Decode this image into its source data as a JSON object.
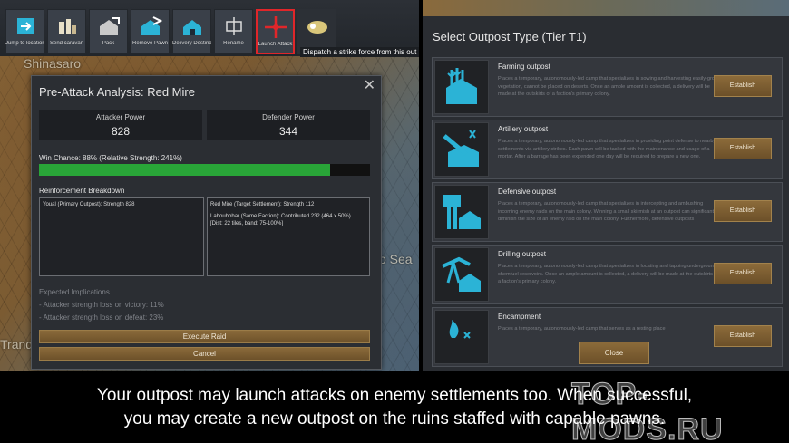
{
  "toolbar": {
    "buttons": [
      {
        "label": "Jump to location",
        "icon": "jump-icon"
      },
      {
        "label": "Send caravan",
        "icon": "caravan-icon"
      },
      {
        "label": "Pack",
        "icon": "pack-icon"
      },
      {
        "label": "Remove Pawn",
        "icon": "remove-pawn-icon"
      },
      {
        "label": "Delivery Destination",
        "icon": "delivery-icon"
      },
      {
        "label": "Rename",
        "icon": "rename-icon"
      },
      {
        "label": "Launch Attack",
        "icon": "crosshair-icon"
      },
      {
        "label": "",
        "icon": "strike-force-icon"
      }
    ],
    "tooltip": "Dispatch a strike force from this out"
  },
  "map": {
    "labels": [
      "Shinasaro",
      "o Sea",
      "Trand"
    ]
  },
  "attack_dialog": {
    "title": "Pre-Attack Analysis: Red Mire",
    "attacker_label": "Attacker Power",
    "attacker_value": "828",
    "defender_label": "Defender Power",
    "defender_value": "344",
    "win_chance_text": "Win Chance: 88% (Relative Strength: 241%)",
    "win_chance": 0.88,
    "reinforcement_label": "Reinforcement Breakdown",
    "reinf_left": [
      "Youal (Primary Outpost): Strength 828"
    ],
    "reinf_right": [
      "Red Mire (Target Settlement): Strength 112",
      "Laboubobar (Same Faction): Contributed 232 (464 x 50%)",
      "[Dist: 22 tiles, band: 75-100%]"
    ],
    "implications_title": "Expected Implications",
    "implications": [
      "- Attacker strength loss on victory: 11%",
      "- Attacker strength loss on defeat: 23%"
    ],
    "execute_label": "Execute Raid",
    "cancel_label": "Cancel"
  },
  "outpost_panel": {
    "title": "Select Outpost Type (Tier T1)",
    "establish_label": "Establish",
    "close_label": "Close",
    "items": [
      {
        "name": "Farming outpost",
        "icon": "farming-icon",
        "desc": "Places a temporary, autonomously-led camp that specializes in sowing and harvesting easily-grown vegetation, cannot be placed on deserts. Once an ample amount is collected, a delivery will be made at the outskirts of a faction's primary colony."
      },
      {
        "name": "Artillery outpost",
        "icon": "artillery-icon",
        "desc": "Places a temporary, autonomously-led camp that specializes in providing point defense to nearby settlements via artillery strikes. Each pawn will be tasked with the maintenance and usage of a mortar. After a barrage has been expended one day will be required to prepare a new one."
      },
      {
        "name": "Defensive outpost",
        "icon": "defensive-icon",
        "desc": "Places a temporary, autonomously-led camp that specializes in intercepting and ambushing incoming enemy raids on the main colony. Winning a small skirmish at an outpost can significantly diminish the size of an enemy raid on the main colony. Furthermore, defensive outposts"
      },
      {
        "name": "Drilling outpost",
        "icon": "drilling-icon",
        "desc": "Places a temporary, autonomously-led camp that specializes in locating and tapping underground chemfuel reservoirs. Once an ample amount is collected, a delivery will be made at the outskirts of a faction's primary colony."
      },
      {
        "name": "Encampment",
        "icon": "encampment-icon",
        "desc": "Places a temporary, autonomously-led camp that serves as a resting place"
      }
    ]
  },
  "caption": {
    "line1": "Your outpost may launch attacks on enemy settlements too. When successful,",
    "line2": "you may create a new outpost on the ruins staffed with capable pawns."
  },
  "watermark": "TOP-MODS.RU",
  "colors": {
    "accent_icon": "#2bb3d6",
    "win_bar": "#29a538",
    "selected_border": "#e0262a",
    "button_brown": "#7c5d31"
  }
}
